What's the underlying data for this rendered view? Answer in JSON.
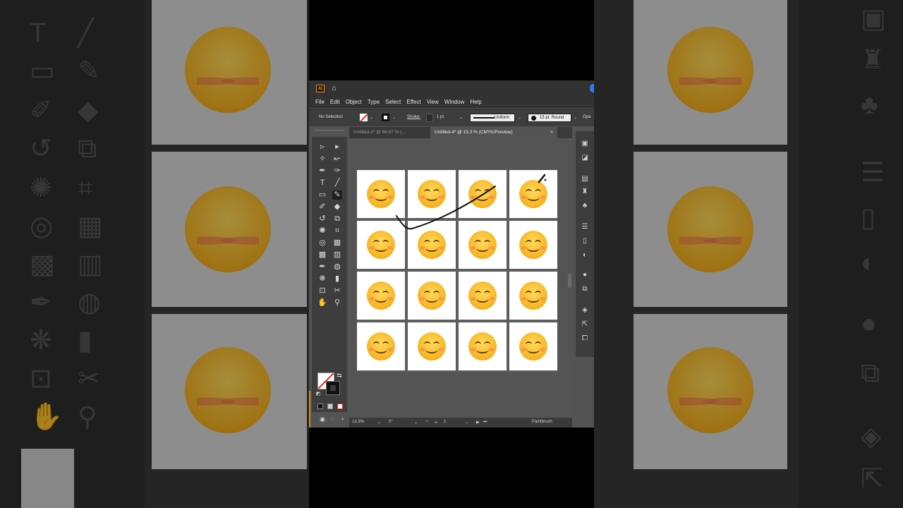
{
  "app": {
    "logo": "Ai",
    "menu": [
      "File",
      "Edit",
      "Object",
      "Type",
      "Select",
      "Effect",
      "View",
      "Window",
      "Help"
    ],
    "control_bar": {
      "selection": "No Selection",
      "stroke_label": "Stroke:",
      "stroke_weight": "1 pt",
      "profile": "Uniform",
      "brush": "15 pt. Round",
      "opacity_label": "Opa"
    },
    "tabs": [
      {
        "label": "Untitled-2* @ 66.67 % (...",
        "active": false
      },
      {
        "label": "Untitled-4* @ 13.3 % (CMYK/Preview)",
        "active": true,
        "close": "×"
      }
    ],
    "status": {
      "zoom": "13.3%",
      "rotation": "0°",
      "artboard": "1",
      "tool": "Paintbrush"
    },
    "artboard_grid": {
      "rows": 4,
      "cols": 4,
      "item": "smiling-face-emoji"
    }
  },
  "colors": {
    "ui_dark": "#323232",
    "ui_panel": "#3d3d3d",
    "canvas": "#535353",
    "accent_orange": "#e38b1a",
    "emoji_yellow": "#f7b624"
  }
}
